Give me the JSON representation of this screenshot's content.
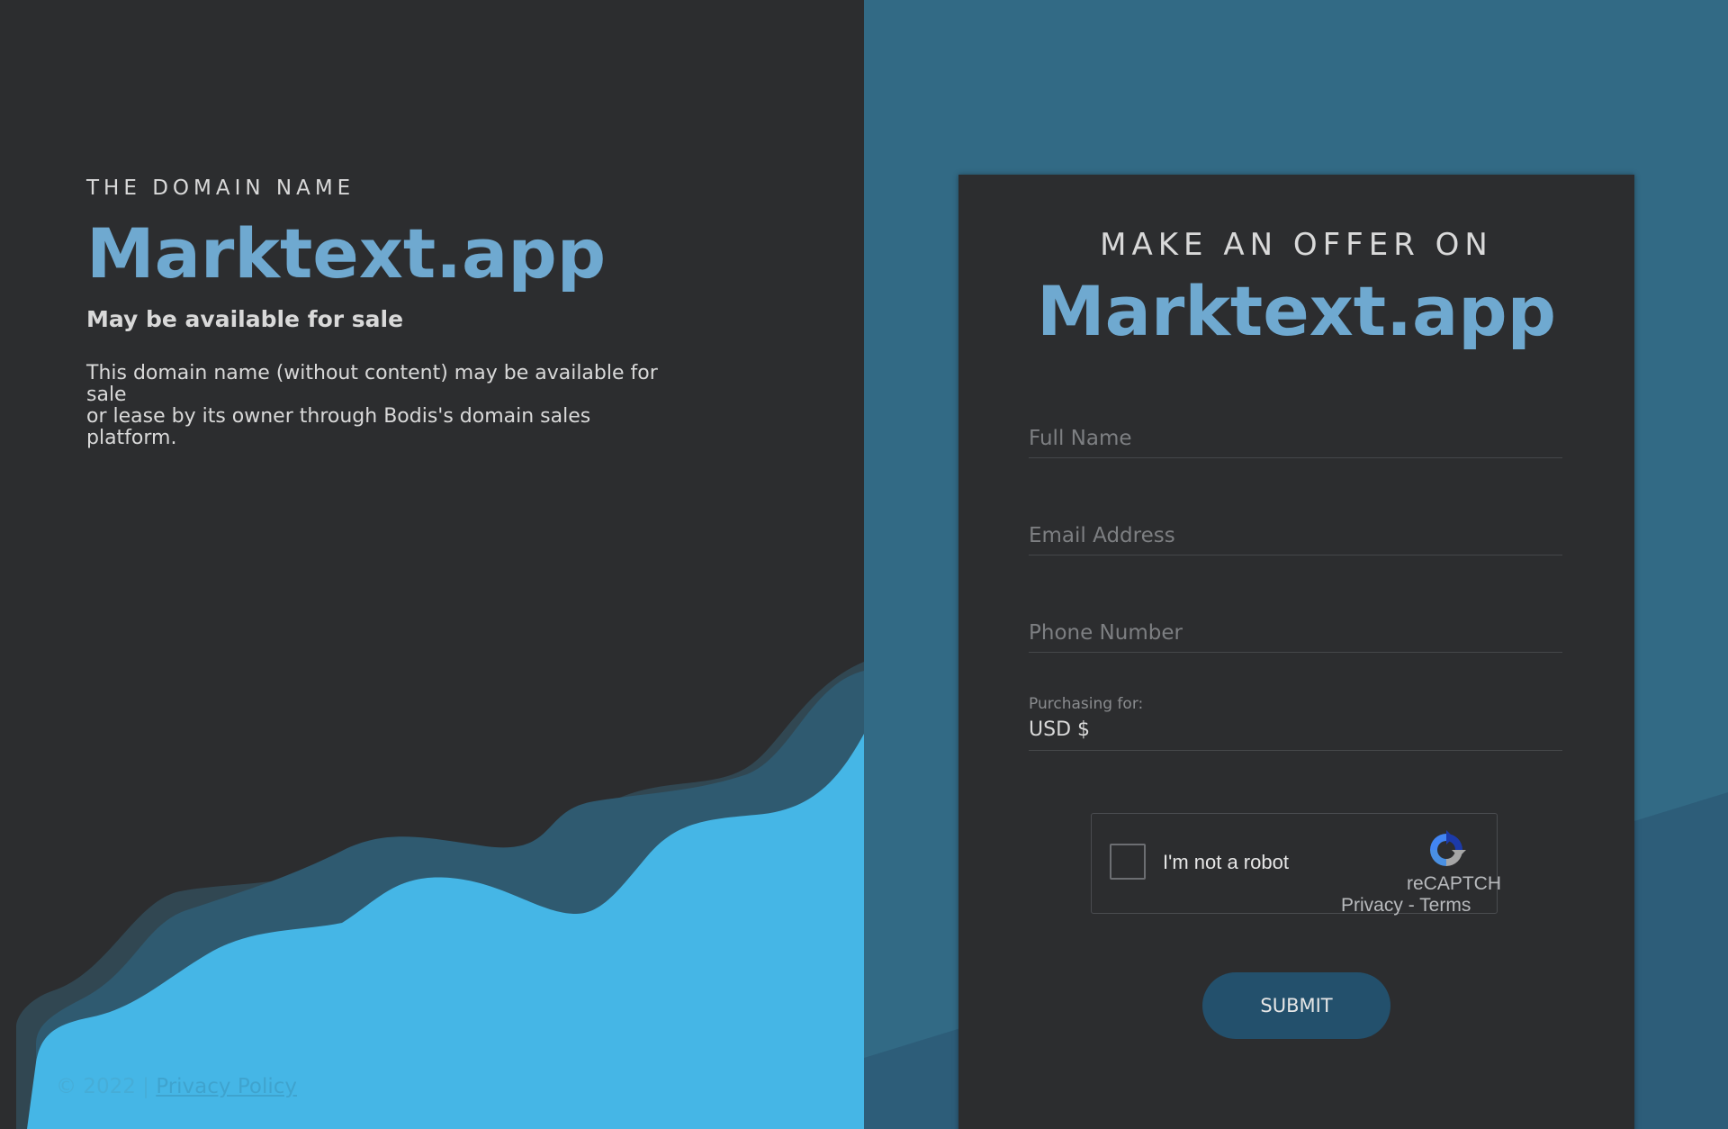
{
  "left": {
    "eyebrow": "THE DOMAIN NAME",
    "domain": "Marktext.app",
    "subheading": "May be available for sale",
    "description_line1": "This domain name (without content) may be available for sale",
    "description_line2": "or lease by its owner through Bodis's domain sales platform."
  },
  "footer": {
    "copyright": "© 2022",
    "separator": "|",
    "privacy_link": "Privacy Policy"
  },
  "offer_card": {
    "eyebrow": "MAKE AN OFFER ON",
    "domain": "Marktext.app",
    "fields": {
      "full_name_placeholder": "Full Name",
      "email_placeholder": "Email Address",
      "phone_placeholder": "Phone Number",
      "currency_label": "Purchasing for:",
      "currency_value": "USD $"
    },
    "captcha": {
      "label": "I'm not a robot",
      "brand": "reCAPTCH",
      "privacy": "Privacy",
      "dash": "-",
      "terms": "Terms"
    },
    "submit_label": "SUBMIT"
  },
  "colors": {
    "left_bg": "#2c2d2f",
    "right_bg": "#326a85",
    "accent_text": "#6fa9d0",
    "wave_light": "#45b6e6",
    "submit_bg": "#23506c"
  },
  "icons": {
    "captcha_logo": "recaptcha-logo-icon"
  }
}
